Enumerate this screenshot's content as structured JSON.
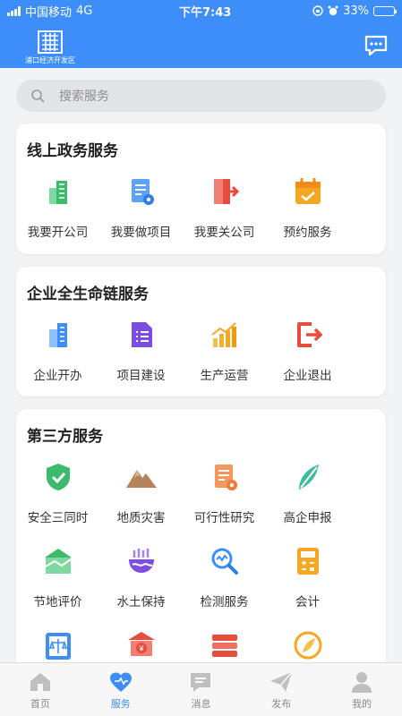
{
  "status_bar": {
    "carrier": "中国移动",
    "network": "4G",
    "time": "下午7:43",
    "battery": "33%",
    "battery_level": 0.33
  },
  "header": {
    "logo_text": "浦口经济开发区",
    "chat_icon": "chat-bubble-icon"
  },
  "search": {
    "placeholder": "搜索服务"
  },
  "sections": [
    {
      "title": "线上政务服务",
      "items": [
        {
          "label": "我要开公司",
          "icon": "building-icon",
          "color": "#3dbb6c"
        },
        {
          "label": "我要做项目",
          "icon": "document-gear-icon",
          "color": "#3d8ef8"
        },
        {
          "label": "我要关公司",
          "icon": "exit-door-icon",
          "color": "#e74c3c"
        },
        {
          "label": "预约服务",
          "icon": "calendar-check-icon",
          "color": "#f5a623"
        }
      ]
    },
    {
      "title": "企业全生命链服务",
      "items": [
        {
          "label": "企业开办",
          "icon": "office-building-icon",
          "color": "#3d8ef8"
        },
        {
          "label": "项目建设",
          "icon": "document-list-icon",
          "color": "#7b4de0"
        },
        {
          "label": "生产运营",
          "icon": "bar-chart-icon",
          "color": "#f5a623"
        },
        {
          "label": "企业退出",
          "icon": "logout-icon",
          "color": "#e74c3c"
        }
      ]
    },
    {
      "title": "第三方服务",
      "items": [
        {
          "label": "安全三同时",
          "icon": "shield-check-icon",
          "color": "#3dbb6c"
        },
        {
          "label": "地质灾害",
          "icon": "mountain-icon",
          "color": "#b5835a"
        },
        {
          "label": "可行性研究",
          "icon": "document-gear-icon",
          "color": "#f07a3a"
        },
        {
          "label": "高企申报",
          "icon": "leaf-icon",
          "color": "#3dbba0"
        },
        {
          "label": "节地评价",
          "icon": "land-icon",
          "color": "#3dbb6c"
        },
        {
          "label": "水土保持",
          "icon": "water-icon",
          "color": "#7b4de0"
        },
        {
          "label": "检测服务",
          "icon": "magnifier-icon",
          "color": "#3d8ef8"
        },
        {
          "label": "会计",
          "icon": "calculator-icon",
          "color": "#f5a623"
        },
        {
          "label": "",
          "icon": "law-book-icon",
          "color": "#3d8ef8"
        },
        {
          "label": "",
          "icon": "bank-icon",
          "color": "#e74c3c"
        },
        {
          "label": "",
          "icon": "books-stack-icon",
          "color": "#e74c3c"
        },
        {
          "label": "",
          "icon": "coin-leaf-icon",
          "color": "#f5a623"
        }
      ]
    }
  ],
  "tabs": [
    {
      "label": "首页",
      "icon": "home-icon"
    },
    {
      "label": "服务",
      "icon": "heart-icon",
      "active": true
    },
    {
      "label": "消息",
      "icon": "message-icon"
    },
    {
      "label": "发布",
      "icon": "send-icon"
    },
    {
      "label": "我的",
      "icon": "user-icon"
    }
  ],
  "colors": {
    "brand": "#3d8ef8",
    "inactive": "#bfbfbf"
  }
}
